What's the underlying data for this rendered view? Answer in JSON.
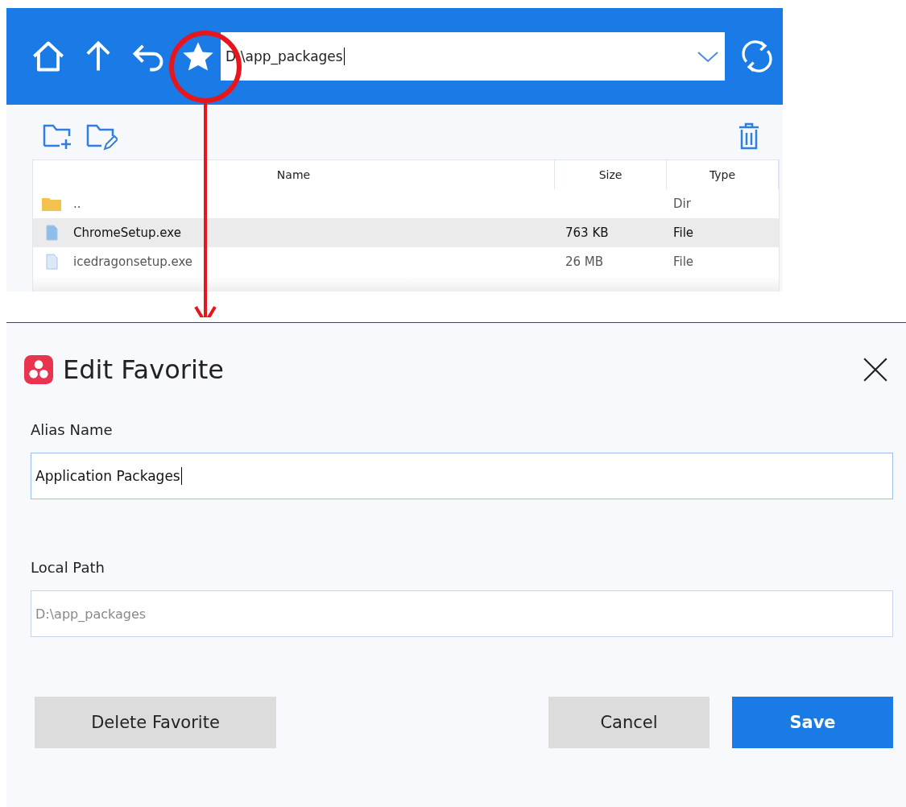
{
  "explorer": {
    "path": "D:\\app_packages",
    "columns": [
      "Name",
      "Size",
      "Type"
    ],
    "rows": [
      {
        "kind": "folder",
        "name": "..",
        "size": "",
        "type": "Dir",
        "selected": false
      },
      {
        "kind": "file",
        "name": "ChromeSetup.exe",
        "size": "763 KB",
        "type": "File",
        "selected": true
      },
      {
        "kind": "file",
        "name": "icedragonsetup.exe",
        "size": "26 MB",
        "type": "File",
        "selected": false
      }
    ]
  },
  "dialog": {
    "title": "Edit Favorite",
    "fields": [
      {
        "label": "Alias Name",
        "value": "Application Packages",
        "disabled": false
      },
      {
        "label": "Local Path",
        "value": "D:\\app_packages",
        "disabled": true
      }
    ],
    "buttons": [
      {
        "label": "Delete Favorite",
        "kind": "secondary"
      },
      {
        "label": "Cancel",
        "kind": "secondary"
      },
      {
        "label": "Save",
        "kind": "primary"
      }
    ]
  }
}
